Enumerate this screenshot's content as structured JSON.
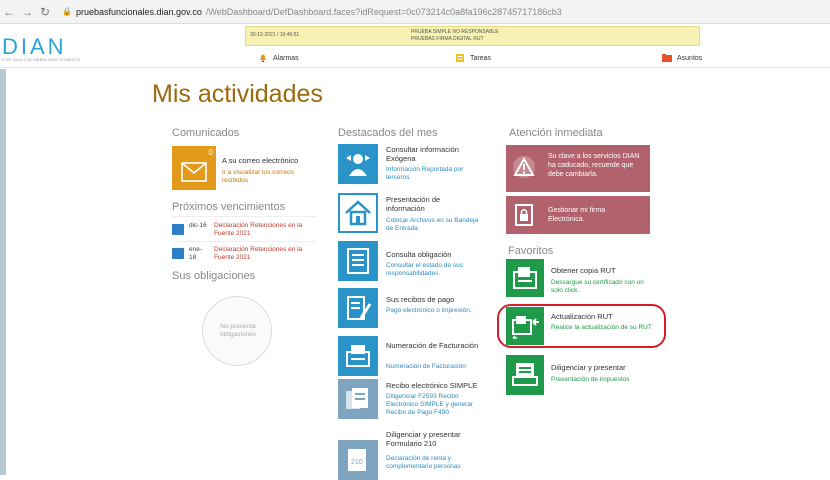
{
  "browser": {
    "url_domain": "pruebasfuncionales.dian.gov.co",
    "url_path": "/WebDashboard/DefDashboard.faces?idRequest=0c073214c0a8fa196c28745717186cb3"
  },
  "header": {
    "logo": "DIAN",
    "tagline": "POR UNA COLOMBIA MÁS HONESTA",
    "notice_date": "30-12-2021 / 10:46:51",
    "notice_line1": "PRUEBA SIMPLE NO RESPONSABLE",
    "notice_line2": "PRUEBAS FIRMA DIGITAL RUT",
    "links": [
      "Alarmas",
      "Tareas",
      "Asuntos"
    ]
  },
  "page": {
    "title": "Mis actividades"
  },
  "comunicados": {
    "heading": "Comunicados",
    "mail_count": "0",
    "mail_label": "A su correo electrónico",
    "mail_sub": "Ir a visualizar los correos recibidos"
  },
  "vencimientos": {
    "heading": "Próximos vencimientos",
    "items": [
      {
        "date": "dic-16",
        "desc": "Declaración Retenciones en la Fuente 2021"
      },
      {
        "date": "ene-18",
        "desc": "Declaración Retenciones en la Fuente 2021"
      }
    ]
  },
  "obligaciones": {
    "heading": "Sus obligaciones",
    "empty": "No presenta obligaciones"
  },
  "destacados": {
    "heading": "Destacados del mes",
    "items": [
      {
        "title": "Consultar información Exógena",
        "sub": "Información Reportada por terceros"
      },
      {
        "title": "Presentación de información",
        "sub": "Colocar Archivos en su Bandeja de Entrada"
      },
      {
        "title": "Consulta obligación",
        "sub": "Consultar el estado de sus responsabilidades."
      },
      {
        "title": "Sus recibos de pago",
        "sub": "Pago electrónico o impresión."
      },
      {
        "title": "Numeración de Facturación",
        "sub": "Numeración de Facturación"
      },
      {
        "title": "Recibo electrónico SIMPLE",
        "sub": "Diligenciar F2593 Recibo Electrónico SIMPLE y generar Recibo de Pago F490"
      },
      {
        "title": "Diligenciar y presentar Formulario 210",
        "sub": "Declaración de renta y complementario personas"
      }
    ]
  },
  "atencion": {
    "heading": "Atención inmediata",
    "items": [
      {
        "text": "Su clave a los servicios DIAN ha caducado, recuerde que debe cambiarla."
      },
      {
        "text": "Gestionar mi firma Electrónica."
      }
    ]
  },
  "favoritos": {
    "heading": "Favoritos",
    "items": [
      {
        "title": "Obtener copia RUT",
        "sub": "Descargue su certificado con un solo click."
      },
      {
        "title": "Actualización RUT",
        "sub": "Realice la actualización de su RUT"
      },
      {
        "title": "Diligenciar y presentar",
        "sub": "Presentación de impuestos"
      }
    ]
  },
  "colors": {
    "title": "#9c6a0c",
    "destacados_tile": "#2a93c8",
    "atencion_tile": "#b2626c",
    "favoritos_tile": "#1f9a4a",
    "highlight": "#d21f2a"
  }
}
